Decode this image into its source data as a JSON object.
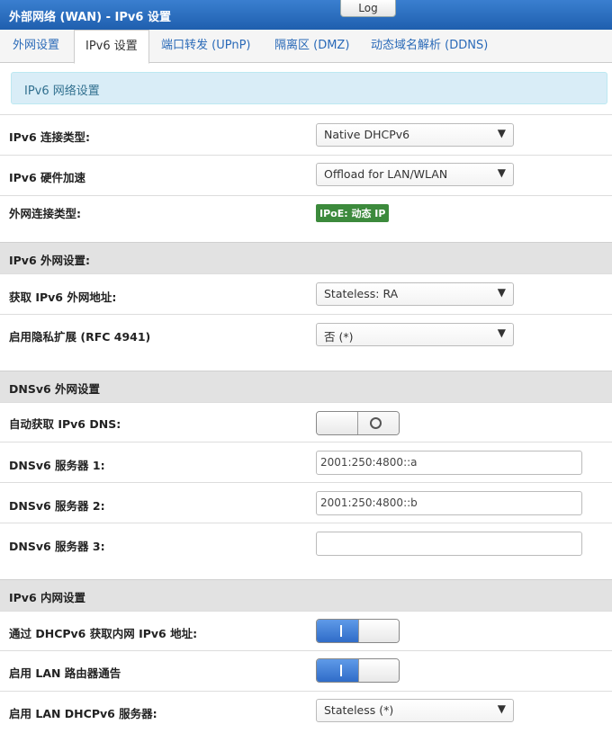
{
  "header": {
    "title": "外部网络 (WAN) - IPv6 设置",
    "log_label": "Log"
  },
  "tabs": [
    {
      "label": "外网设置"
    },
    {
      "label": "IPv6 设置"
    },
    {
      "label": "端口转发 (UPnP)"
    },
    {
      "label": "隔离区 (DMZ)"
    },
    {
      "label": "动态域名解析 (DDNS)"
    }
  ],
  "info": "IPv6 网络设置",
  "general": {
    "conn_type": {
      "label": "IPv6 连接类型:",
      "value": "Native DHCPv6"
    },
    "hw_accel": {
      "label": "IPv6 硬件加速",
      "value": "Offload for LAN/WLAN"
    },
    "wan_type": {
      "label": "外网连接类型:",
      "badge": "IPoE: 动态 IP"
    }
  },
  "wan_section": {
    "title": "IPv6 外网设置:",
    "get_addr": {
      "label": "获取 IPv6 外网地址:",
      "value": "Stateless: RA"
    },
    "privacy": {
      "label": "启用隐私扩展 (RFC 4941)",
      "value": "否 (*)"
    }
  },
  "dns_section": {
    "title": "DNSv6 外网设置",
    "auto_dns": {
      "label": "自动获取 IPv6 DNS:",
      "state": "off"
    },
    "server1": {
      "label": "DNSv6 服务器 1:",
      "value": "2001:250:4800::a"
    },
    "server2": {
      "label": "DNSv6 服务器 2:",
      "value": "2001:250:4800::b"
    },
    "server3": {
      "label": "DNSv6 服务器 3:",
      "value": ""
    }
  },
  "lan_section": {
    "title": "IPv6 内网设置",
    "dhcp_lan": {
      "label": "通过 DHCPv6 获取内网 IPv6 地址:",
      "state": "on"
    },
    "router_adv": {
      "label": "启用 LAN 路由器通告",
      "state": "on"
    },
    "dhcp_server": {
      "label": "启用 LAN DHCPv6 服务器:",
      "value": "Stateless (*)"
    }
  },
  "icons": {
    "dropdown": "chevron-down-icon"
  }
}
